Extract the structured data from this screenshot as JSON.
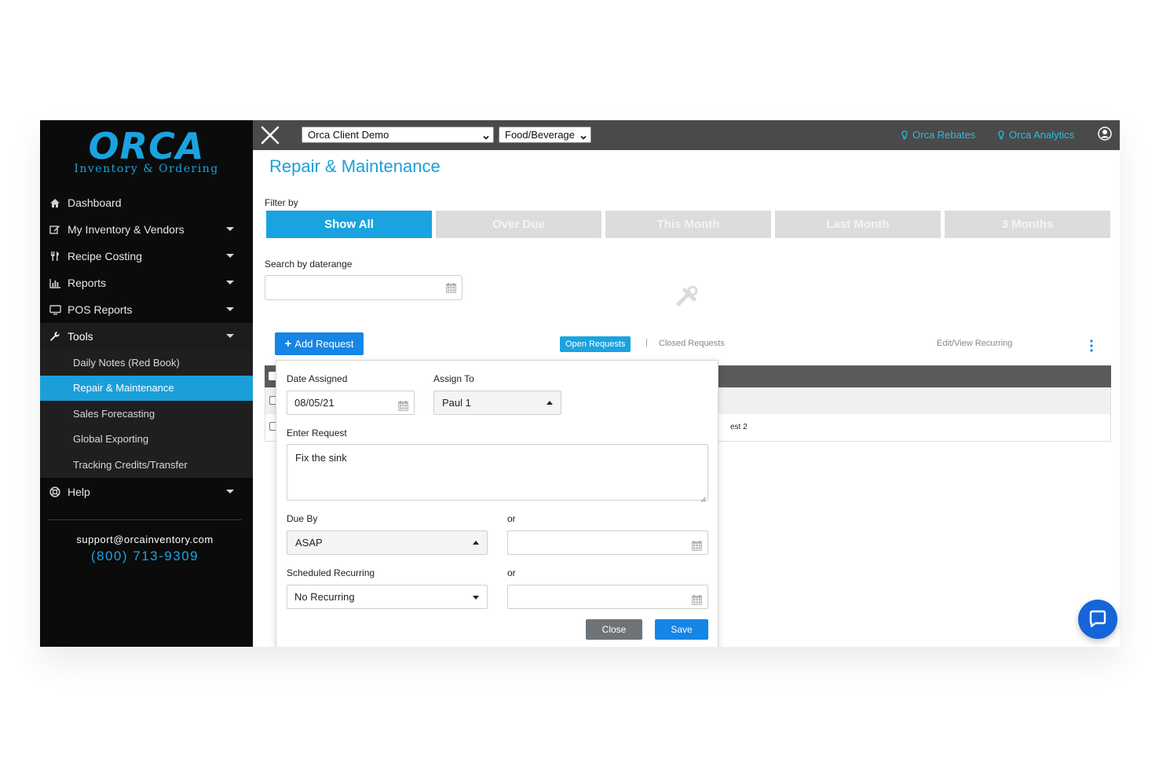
{
  "brand": {
    "logo_word": "ORCA",
    "logo_sub": "Inventory & Ordering",
    "accent": "#1aa3e0"
  },
  "sidebar": {
    "items": [
      {
        "label": "Dashboard",
        "icon": "home-icon"
      },
      {
        "label": "My Inventory & Vendors",
        "icon": "edit-icon"
      },
      {
        "label": "Recipe Costing",
        "icon": "utensils-icon"
      },
      {
        "label": "Reports",
        "icon": "bar-chart-icon"
      },
      {
        "label": "POS Reports",
        "icon": "monitor-icon"
      },
      {
        "label": "Tools",
        "icon": "wrench-icon"
      }
    ],
    "sub_items": [
      {
        "label": "Daily Notes (Red Book)"
      },
      {
        "label": "Repair & Maintenance"
      },
      {
        "label": "Sales Forecasting"
      },
      {
        "label": "Global Exporting"
      },
      {
        "label": "Tracking Credits/Transfer"
      }
    ],
    "help": {
      "label": "Help",
      "icon": "lifebuoy-icon"
    },
    "support_email": "support@orcainventory.com",
    "phone": "(800) 713-9309"
  },
  "topbar": {
    "client_select": "Orca Client Demo",
    "category_select": "Food/Beverage",
    "rebates": "Orca Rebates",
    "analytics": "Orca Analytics"
  },
  "main": {
    "title": "Repair & Maintenance",
    "filter_label": "Filter by",
    "filters": [
      "Show All",
      "Over Due",
      "This Month",
      "Last Month",
      "3 Months"
    ],
    "active_filter": "Show All",
    "search_label": "Search by daterange",
    "search_value": "",
    "add_request": "Add Request",
    "tabs": {
      "open": "Open Requests",
      "separator": "|",
      "closed": "Closed Requests"
    },
    "edit_recurring": "Edit/View Recurring",
    "table": {
      "row2_partial": "est 2"
    }
  },
  "popup": {
    "date_assigned_label": "Date Assigned",
    "date_assigned_value": "08/05/21",
    "assign_to_label": "Assign To",
    "assign_to_value": "Paul 1",
    "enter_request_label": "Enter Request",
    "request_value": "Fix the sink",
    "due_by_label": "Due By",
    "due_by_value": "ASAP",
    "or_label": "or",
    "due_date_value": "",
    "scheduled_label": "Scheduled Recurring",
    "scheduled_value": "No Recurring",
    "scheduled_date_value": "",
    "close": "Close",
    "save": "Save"
  }
}
